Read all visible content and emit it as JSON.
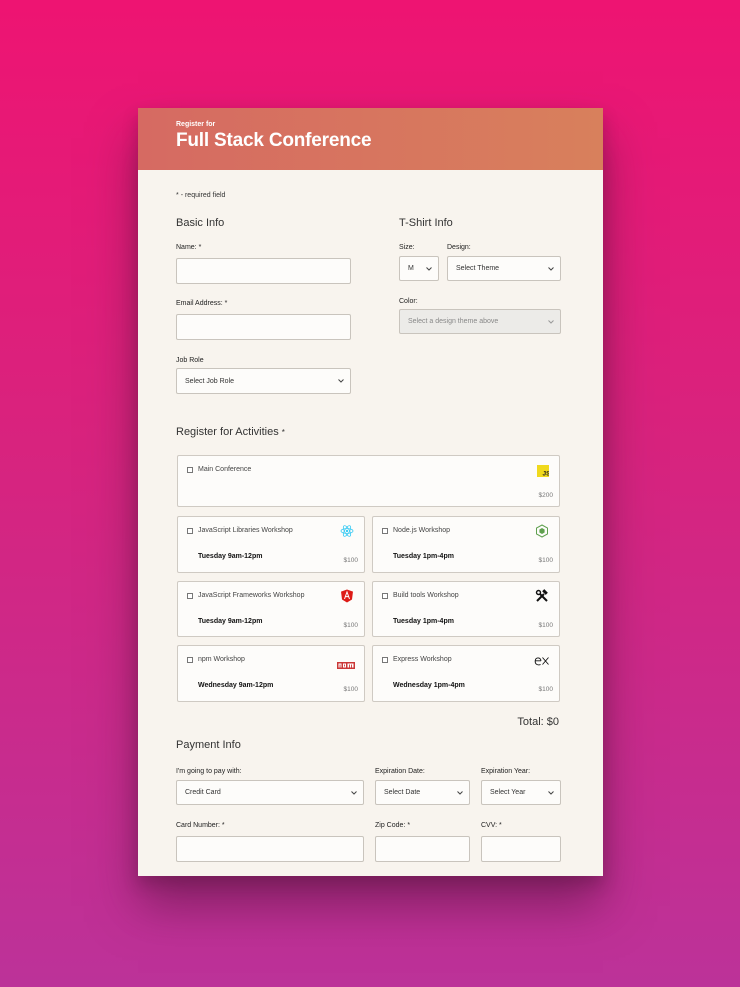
{
  "header": {
    "subtitle": "Register for",
    "title": "Full Stack Conference"
  },
  "required_note": {
    "marker": "*",
    "text": "- required field"
  },
  "basic_info": {
    "title": "Basic Info",
    "name_label": "Name:",
    "name_value": "",
    "email_label": "Email Address:",
    "email_value": "",
    "job_role_label": "Job Role",
    "job_role_selected": "Select Job Role"
  },
  "tshirt_info": {
    "title": "T-Shirt Info",
    "size_label": "Size:",
    "size_selected": "M",
    "design_label": "Design:",
    "design_selected": "Select Theme",
    "color_label": "Color:",
    "color_selected": "Select a design theme above"
  },
  "activities": {
    "title": "Register for Activities",
    "main": {
      "name": "Main Conference",
      "price": "$200",
      "icon": "javascript-logo-icon"
    },
    "workshops": [
      {
        "name": "JavaScript Libraries Workshop",
        "time": "Tuesday 9am-12pm",
        "price": "$100",
        "icon": "react-logo-icon"
      },
      {
        "name": "Node.js Workshop",
        "time": "Tuesday 1pm-4pm",
        "price": "$100",
        "icon": "nodejs-logo-icon"
      },
      {
        "name": "JavaScript Frameworks Workshop",
        "time": "Tuesday 9am-12pm",
        "price": "$100",
        "icon": "angular-logo-icon"
      },
      {
        "name": "Build tools Workshop",
        "time": "Tuesday 1pm-4pm",
        "price": "$100",
        "icon": "tools-icon"
      },
      {
        "name": "npm Workshop",
        "time": "Wednesday 9am-12pm",
        "price": "$100",
        "icon": "npm-logo-icon"
      },
      {
        "name": "Express Workshop",
        "time": "Wednesday 1pm-4pm",
        "price": "$100",
        "icon": "express-logo-icon"
      }
    ],
    "total": "Total: $0"
  },
  "payment": {
    "title": "Payment Info",
    "method_label": "I'm going to pay with:",
    "method_selected": "Credit Card",
    "exp_date_label": "Expiration Date:",
    "exp_date_selected": "Select Date",
    "exp_year_label": "Expiration Year:",
    "exp_year_selected": "Select Year",
    "card_number_label": "Card Number:",
    "zip_label": "Zip Code:",
    "cvv_label": "CVV:"
  },
  "colors": {
    "background_top": "#ee1472",
    "background_bottom": "#bc3299",
    "header_start": "#d66a62",
    "header_end": "#d8805c",
    "card": "#f8f4ee"
  }
}
